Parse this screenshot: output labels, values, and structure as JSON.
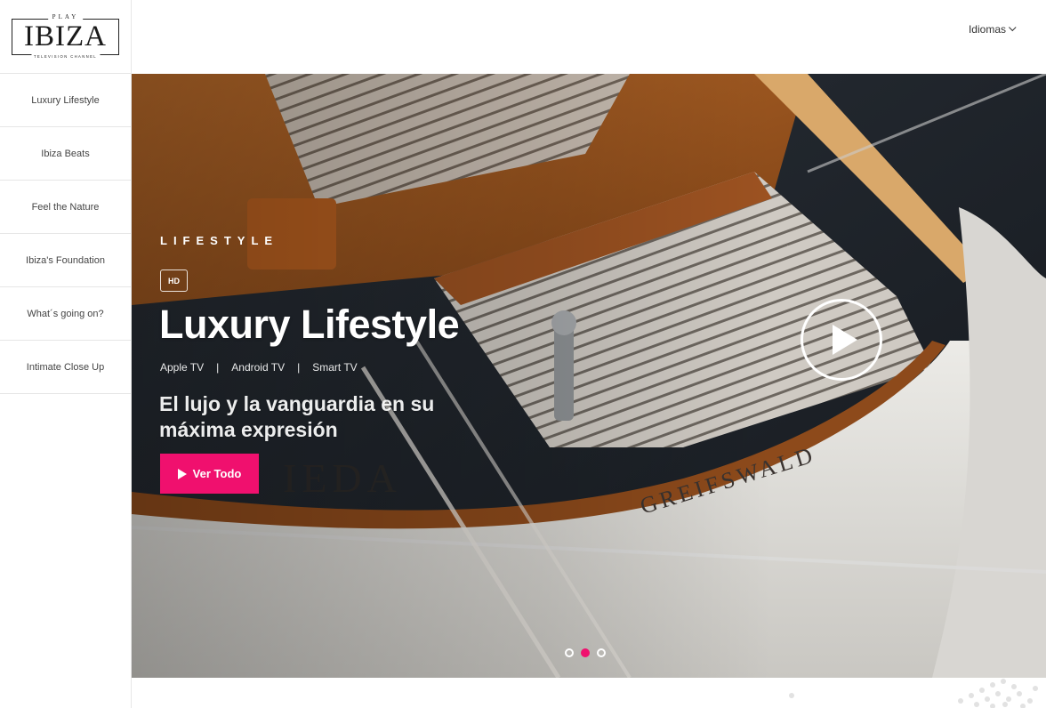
{
  "logo": {
    "top": "PLAY",
    "main": "IBIZA",
    "bottom": "TELEVISION CHANNEL"
  },
  "sidebar": {
    "items": [
      {
        "label": "Luxury Lifestyle"
      },
      {
        "label": "Ibiza Beats"
      },
      {
        "label": "Feel the Nature"
      },
      {
        "label": "Ibiza's Foundation"
      },
      {
        "label": "What´s going on?"
      },
      {
        "label": "Intimate Close Up"
      }
    ]
  },
  "header": {
    "language_label": "Idiomas",
    "language_icon": "chevron-down-icon"
  },
  "hero": {
    "eyebrow": "LIFESTYLE",
    "badge": "HD",
    "title": "Luxury Lifestyle",
    "platforms": [
      "Apple TV",
      "Android TV",
      "Smart TV"
    ],
    "platform_separator": "|",
    "subtitle": "El lujo y la vanguardia en su máxima expresión",
    "boat_name": "GREIFSWALD",
    "boat_name_partial": "IEDA",
    "cta_label": "Ver Todo",
    "cta_icon": "play-icon",
    "play_icon": "play-circle-icon",
    "slides_count": 3,
    "active_slide": 2
  },
  "colors": {
    "accent": "#f0106e",
    "sidebar_border": "#e6e6e6",
    "text_dark": "#444444"
  }
}
